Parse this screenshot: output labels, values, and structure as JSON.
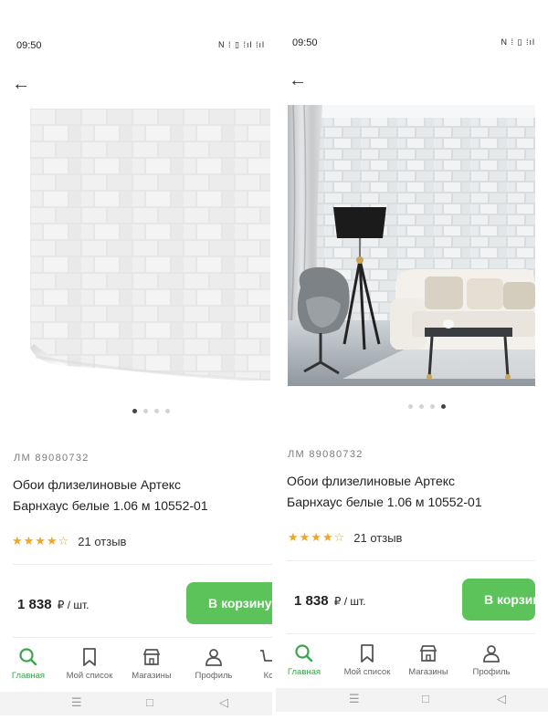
{
  "screens": [
    {
      "status_time": "09:50",
      "status_icons": "N ⁞ ▯ ⁞ıl ⁞ıl",
      "dots": [
        true,
        false,
        false,
        false
      ],
      "sku": "ЛМ 89080732",
      "title_line1": "Обои флизелиновые Артекс",
      "title_line2": "Барнхаус белые 1.06 м 10552-01",
      "stars": "★★★★☆",
      "rating": 3.5,
      "reviews": "21 отзыв",
      "price": "1 838",
      "price_unit": "₽ / шт.",
      "cart_label": "В корзину",
      "tabs": [
        "Главная",
        "Мой список",
        "Магазины",
        "Профиль",
        "Ко"
      ]
    },
    {
      "status_time": "09:50",
      "status_icons": "N ⁞ ▯ ⁞ıl",
      "dots": [
        false,
        false,
        false,
        true
      ],
      "sku": "ЛМ 89080732",
      "title_line1": "Обои флизелиновые Артекс",
      "title_line2": "Барнхаус белые 1.06 м 10552-01",
      "stars": "★★★★☆",
      "rating": 3.5,
      "reviews": "21 отзыв",
      "price": "1 838",
      "price_unit": "₽ / шт.",
      "cart_label": "В корзину",
      "tabs": [
        "Главная",
        "Мой список",
        "Магазины",
        "Профиль"
      ]
    }
  ],
  "colors": {
    "accent": "#5cc35a",
    "active_tab": "#3aa54c",
    "star": "#f2a524"
  },
  "icons": {
    "back": "arrow-left-icon",
    "home": "search-icon",
    "list": "bookmark-icon",
    "stores": "store-icon",
    "profile": "person-icon"
  }
}
